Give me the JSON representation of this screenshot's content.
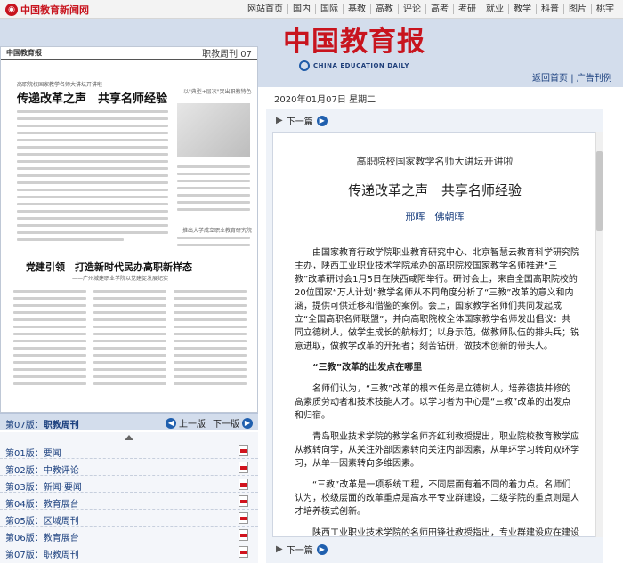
{
  "site": {
    "logo_text": "中国教育新闻网",
    "nav": [
      "网站首页",
      "国内",
      "国际",
      "基教",
      "高教",
      "评论",
      "高考",
      "考研",
      "就业",
      "教学",
      "科普",
      "图片",
      "桃宇"
    ]
  },
  "masthead": {
    "title": "中国教育报",
    "subtitle": "CHINA EDUCATION DAILY"
  },
  "header_links": {
    "home": "返回首页",
    "separator": "|",
    "guide": "广告刊例"
  },
  "date": "2020年01月07日 星期二",
  "page_preview": {
    "mini_masthead": "中国教育报",
    "issue": "职教周刊 07",
    "kicker": "高职院校国家教学名师大讲坛开讲啦",
    "headline1": "传递改革之声　共享名师经验",
    "side1": "以\"典型+层次\"突出职教特色",
    "side2": "推出大学成立职业教育研究院",
    "headline2": "党建引领　打造新时代民办高职新样态",
    "sub2": "——广州城建职业学院以党建促发展纪实"
  },
  "edition_bar": {
    "current_num": "第07版：",
    "current_name": "职教周刊",
    "prev_label": "上一版",
    "next_label": "下一版"
  },
  "editions": [
    {
      "num": "第01版：",
      "name": "要闻"
    },
    {
      "num": "第02版：",
      "name": "中教评论"
    },
    {
      "num": "第03版：",
      "name": "新闻·要闻"
    },
    {
      "num": "第04版：",
      "name": "教育展台"
    },
    {
      "num": "第05版：",
      "name": "区域周刊"
    },
    {
      "num": "第06版：",
      "name": "教育展台"
    },
    {
      "num": "第07版：",
      "name": "职教周刊"
    }
  ],
  "article": {
    "next_label": "下一篇",
    "kicker": "高职院校国家教学名师大讲坛开讲啦",
    "title": "传递改革之声　共享名师经验",
    "authors": "邢晖　佛朝晖",
    "para1": "由国家教育行政学院职业教育研究中心、北京智慧云教育科学研究院主办，陕西工业职业技术学院承办的高职院校国家教学名师推进“三教”改革研讨会1月5日在陕西咸阳举行。研讨会上，来自全国高职院校的20位国家“万人计划”教学名师从不同角度分析了“三教”改革的意义和内涵，提供可供迁移和借鉴的案例。会上，国家教学名师们共同发起成立“全国高职名师联盟”，并向高职院校全体国家教学名师发出倡议：共同立德树人，做学生成长的航标灯；以身示范，做教师队伍的排头兵；锐意进取，做教学改革的开拓者；刻苦钻研，做技术创新的带头人。",
    "section1": "“三教”改革的出发点在哪里",
    "para2": "名师们认为，“三教”改革的根本任务是立德树人，培养德技并修的高素质劳动者和技术技能人才。以学习者为中心是“三教”改革的出发点和归宿。",
    "para3": "青岛职业技术学院的教学名师齐红利教授提出，职业院校教育教学应从教转向学，从关注外部因素转向关注内部因素，从单环学习转向双环学习，从单一因素转向多维因素。",
    "para4": "“三教”改革是一项系统工程，不同层面有着不同的着力点。名师们认为，校级层面的改革重点是高水平专业群建设，二级学院的重点则是人才培养模式创新。",
    "para5": "陕西工业职业技术学院的名师田锋社教授指出，专业群建设应在建设的逻辑起点、技术技能创新平台、课程体系、教学内容、实训基地建设、"
  }
}
